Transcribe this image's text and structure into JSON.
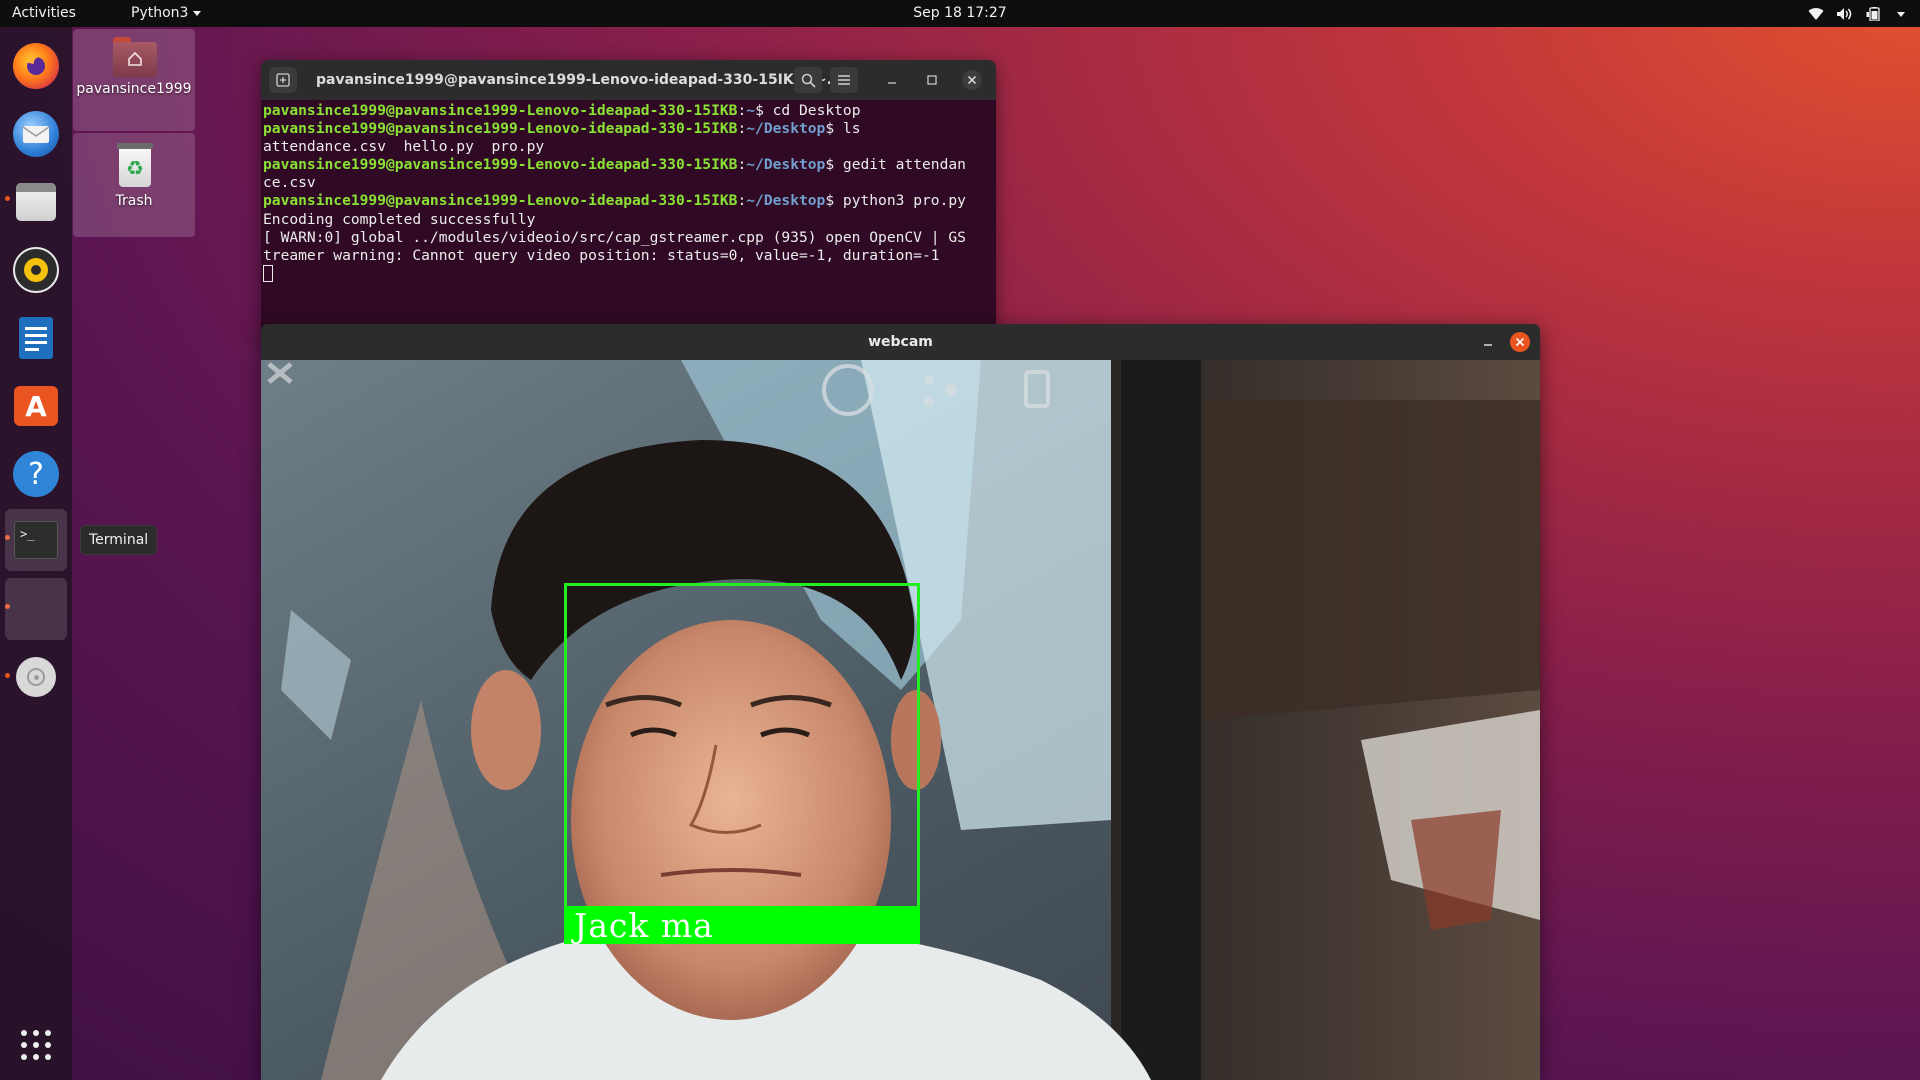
{
  "topbar": {
    "activities": "Activities",
    "app_menu": "Python3",
    "clock": "Sep 18  17:27",
    "tray_icons": [
      "wifi-icon",
      "volume-icon",
      "battery-icon",
      "system-menu-caret-icon"
    ]
  },
  "dock": {
    "items": [
      {
        "name": "firefox",
        "icon": "firefox-icon",
        "running": false
      },
      {
        "name": "thunderbird",
        "icon": "thunderbird-icon",
        "running": false
      },
      {
        "name": "files",
        "icon": "files-icon",
        "running": true
      },
      {
        "name": "rhythmbox",
        "icon": "rhythmbox-icon",
        "running": false
      },
      {
        "name": "libreoffice-writer",
        "icon": "writer-icon",
        "running": false
      },
      {
        "name": "ubuntu-software",
        "icon": "software-icon",
        "running": false
      },
      {
        "name": "help",
        "icon": "help-icon",
        "running": false
      },
      {
        "name": "terminal",
        "icon": "terminal-icon",
        "running": true
      },
      {
        "name": "webcam-window",
        "icon": "blank-app-icon",
        "running": true
      },
      {
        "name": "optical-drive",
        "icon": "disc-icon",
        "running": true
      }
    ],
    "tooltip": "Terminal",
    "show_apps_icon": "grid-icon"
  },
  "desktop": {
    "home_label": "pavansince1999",
    "trash_label": "Trash"
  },
  "terminal": {
    "title": "pavansince1999@pavansince1999-Lenovo-ideapad-330-15IKB: ~...",
    "lines": [
      {
        "user": "pavansince1999@pavansince1999-Lenovo-ideapad-330-15IKB",
        "path": "~",
        "cmd": "$ cd Desktop"
      },
      {
        "user": "pavansince1999@pavansince1999-Lenovo-ideapad-330-15IKB",
        "path": "~/Desktop",
        "cmd": "$ ls"
      },
      {
        "text": "attendance.csv  hello.py  pro.py"
      },
      {
        "user": "pavansince1999@pavansince1999-Lenovo-ideapad-330-15IKB",
        "path": "~/Desktop",
        "cmd": "$ gedit attendan"
      },
      {
        "text": "ce.csv"
      },
      {
        "user": "pavansince1999@pavansince1999-Lenovo-ideapad-330-15IKB",
        "path": "~/Desktop",
        "cmd": "$ python3 pro.py"
      },
      {
        "text": "Encoding completed successfully"
      },
      {
        "text": "[ WARN:0] global ../modules/videoio/src/cap_gstreamer.cpp (935) open OpenCV | GS"
      },
      {
        "text": "treamer warning: Cannot query video position: status=0, value=-1, duration=-1"
      }
    ]
  },
  "webcam": {
    "title": "webcam",
    "detected_name": "Jack ma"
  },
  "colors": {
    "accent": "#e95420",
    "terminal_bg": "#300a24",
    "prompt_user": "#8ae234",
    "prompt_path": "#729fcf",
    "face_box": "#00ff00"
  }
}
